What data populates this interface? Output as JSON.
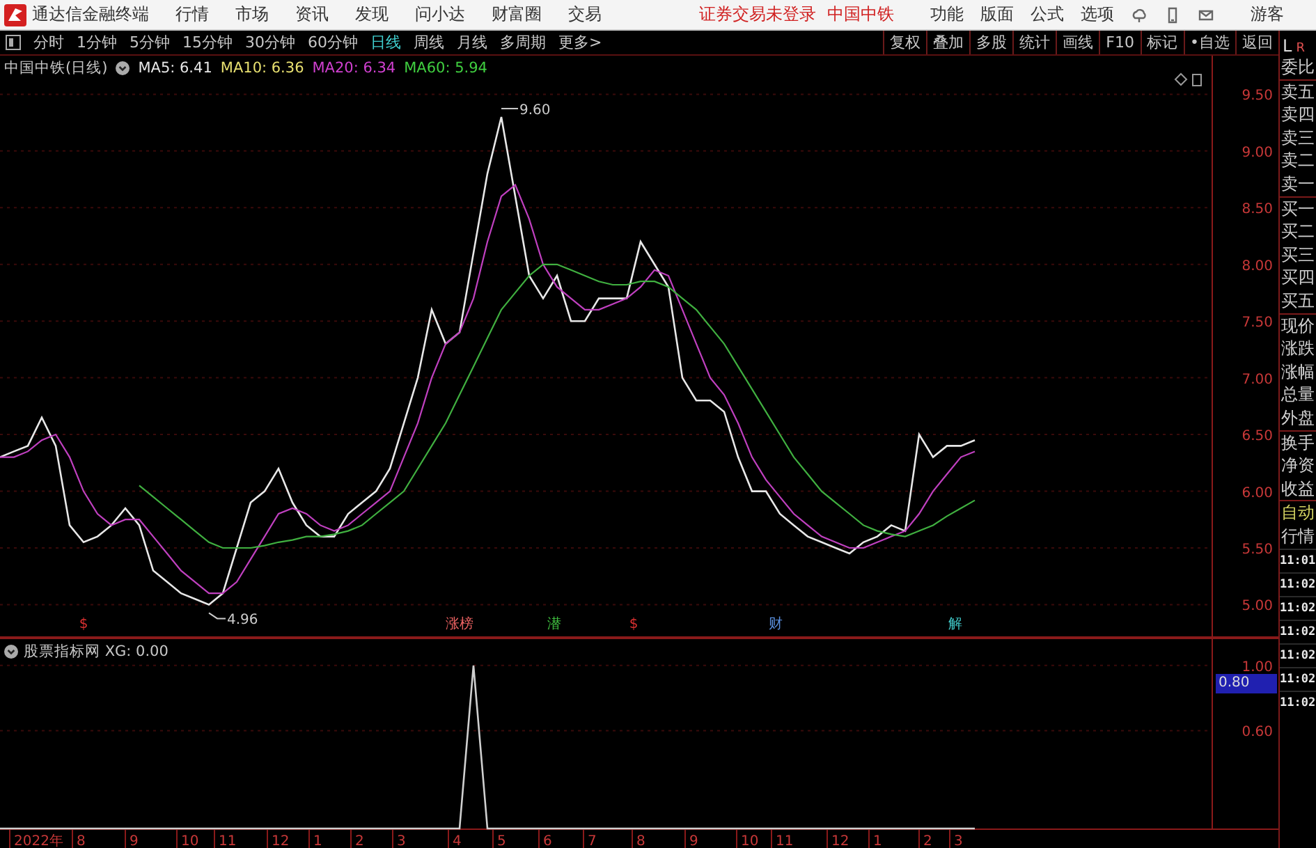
{
  "title_bar": {
    "app_title": "通达信金融终端",
    "menus": [
      "行情",
      "市场",
      "资讯",
      "发现",
      "问小达",
      "财富圈",
      "交易"
    ],
    "login_status": "证券交易未登录",
    "stock_name": "中国中铁",
    "tools": [
      "功能",
      "版面",
      "公式",
      "选项"
    ],
    "user": "游客"
  },
  "period_bar": {
    "periods": [
      {
        "label": "分时",
        "selected": false
      },
      {
        "label": "1分钟",
        "selected": false
      },
      {
        "label": "5分钟",
        "selected": false
      },
      {
        "label": "15分钟",
        "selected": false
      },
      {
        "label": "30分钟",
        "selected": false
      },
      {
        "label": "60分钟",
        "selected": false
      },
      {
        "label": "日线",
        "selected": true
      },
      {
        "label": "周线",
        "selected": false
      },
      {
        "label": "月线",
        "selected": false
      },
      {
        "label": "多周期",
        "selected": false
      },
      {
        "label": "更多>",
        "selected": false
      }
    ],
    "buttons": [
      "复权",
      "叠加",
      "多股",
      "统计",
      "画线",
      "F10",
      "标记",
      "•自选",
      "返回"
    ]
  },
  "main_chart": {
    "legend": {
      "title": "中国中铁(日线)",
      "ma": [
        {
          "label": "MA5: 6.41",
          "color": "#e8e8e8"
        },
        {
          "label": "MA10: 6.36",
          "color": "#e8e070"
        },
        {
          "label": "MA20: 6.34",
          "color": "#d040d0"
        },
        {
          "label": "MA60: 5.94",
          "color": "#40d040"
        }
      ]
    },
    "event_markers": [
      {
        "label": "$",
        "color": "#d83030"
      },
      {
        "label": "涨榜",
        "color": "#e86060"
      },
      {
        "label": "潜",
        "color": "#40c040"
      },
      {
        "label": "$",
        "color": "#d83030"
      },
      {
        "label": "财",
        "color": "#5a90e0"
      },
      {
        "label": "解",
        "color": "#40c8c8"
      }
    ],
    "chart_data": {
      "type": "line",
      "grid": true,
      "ylim": [
        4.72,
        9.84
      ],
      "yticks": [
        {
          "value": 5,
          "label": "5.00"
        },
        {
          "value": 5.5,
          "label": "5.50"
        },
        {
          "value": 6,
          "label": "6.00"
        },
        {
          "value": 6.5,
          "label": "6.50"
        },
        {
          "value": 7,
          "label": "7.00"
        },
        {
          "value": 7.5,
          "label": "7.50"
        },
        {
          "value": 8,
          "label": "8.00"
        },
        {
          "value": 8.5,
          "label": "8.50"
        },
        {
          "value": 9,
          "label": "9.00"
        },
        {
          "value": 9.5,
          "label": "9.50"
        }
      ],
      "categories": [
        null,
        null,
        null,
        null,
        null,
        null,
        null,
        null,
        null,
        null,
        null,
        null,
        null,
        null,
        null,
        null,
        null,
        null,
        null,
        null,
        null,
        null,
        null,
        null,
        null,
        null,
        null,
        null,
        null,
        null,
        null,
        null,
        null,
        null,
        null,
        null,
        null,
        null,
        null,
        null,
        null,
        null,
        null,
        null,
        null,
        null,
        null,
        null,
        null,
        null,
        null,
        null,
        null,
        null,
        null,
        null,
        null,
        null,
        null,
        null,
        null,
        null,
        null,
        null,
        null,
        null,
        null,
        null,
        null,
        null,
        null
      ],
      "series": [
        {
          "color": "#e8e8e8",
          "values": [
            6.3,
            6.35,
            6.4,
            6.65,
            6.4,
            5.7,
            5.55,
            5.6,
            5.7,
            5.85,
            5.7,
            5.3,
            5.2,
            5.1,
            5.05,
            5.0,
            5.1,
            5.5,
            5.9,
            6.0,
            6.2,
            5.9,
            5.7,
            5.6,
            5.6,
            5.8,
            5.9,
            6.0,
            6.2,
            6.6,
            7.0,
            7.6,
            7.3,
            7.4,
            8.1,
            8.8,
            9.3,
            8.6,
            7.9,
            7.7,
            7.9,
            7.5,
            7.5,
            7.7,
            7.7,
            7.7,
            8.2,
            8.0,
            7.8,
            7.0,
            6.8,
            6.8,
            6.7,
            6.3,
            6.0,
            6.0,
            5.8,
            5.7,
            5.6,
            5.55,
            5.5,
            5.45,
            5.55,
            5.6,
            5.7,
            5.65,
            6.5,
            6.3,
            6.4,
            6.4,
            6.45
          ]
        },
        {
          "color": "#c040c0",
          "values": [
            6.3,
            6.3,
            6.35,
            6.45,
            6.5,
            6.3,
            6.0,
            5.8,
            5.7,
            5.75,
            5.75,
            5.6,
            5.45,
            5.3,
            5.2,
            5.1,
            5.1,
            5.2,
            5.4,
            5.6,
            5.8,
            5.85,
            5.8,
            5.7,
            5.65,
            5.7,
            5.8,
            5.9,
            6.0,
            6.3,
            6.6,
            7.0,
            7.3,
            7.4,
            7.7,
            8.2,
            8.6,
            8.7,
            8.4,
            8.0,
            7.8,
            7.7,
            7.6,
            7.6,
            7.65,
            7.7,
            7.8,
            7.95,
            7.9,
            7.6,
            7.3,
            7.0,
            6.85,
            6.6,
            6.3,
            6.1,
            5.95,
            5.8,
            5.7,
            5.6,
            5.55,
            5.5,
            5.5,
            5.55,
            5.6,
            5.65,
            5.8,
            6.0,
            6.15,
            6.3,
            6.35
          ]
        },
        {
          "color": "#40b040",
          "values": [
            null,
            null,
            null,
            null,
            null,
            null,
            null,
            null,
            null,
            null,
            6.05,
            5.95,
            5.85,
            5.75,
            5.65,
            5.55,
            5.5,
            5.5,
            5.5,
            5.52,
            5.55,
            5.57,
            5.6,
            5.6,
            5.62,
            5.65,
            5.7,
            5.8,
            5.9,
            6.0,
            6.2,
            6.4,
            6.6,
            6.85,
            7.1,
            7.35,
            7.6,
            7.75,
            7.9,
            8.0,
            8.0,
            7.95,
            7.9,
            7.85,
            7.82,
            7.82,
            7.85,
            7.85,
            7.8,
            7.7,
            7.6,
            7.45,
            7.3,
            7.1,
            6.9,
            6.7,
            6.5,
            6.3,
            6.15,
            6.0,
            5.9,
            5.8,
            5.7,
            5.65,
            5.62,
            5.6,
            5.65,
            5.7,
            5.78,
            5.85,
            5.92
          ]
        }
      ],
      "annotations": [
        {
          "text": "9.60"
        },
        {
          "text": "4.96"
        }
      ]
    }
  },
  "indicator": {
    "legend": "股票指标网 XG: 0.00",
    "cursor_value": "0.80",
    "date_axis": [
      "2022年",
      "8",
      "9",
      "10",
      "11",
      "12",
      "1",
      "2",
      "3",
      "4",
      "5",
      "6",
      "7",
      "8",
      "9",
      "10",
      "11",
      "12",
      "1",
      "2",
      "3"
    ],
    "chart_data": {
      "type": "line",
      "grid": true,
      "ylim": [
        0,
        1.17
      ],
      "yticks": [
        {
          "value": 1,
          "label": "1.00"
        },
        {
          "value": 0.6,
          "label": "0.60"
        }
      ],
      "categories": [
        null,
        null,
        null,
        null,
        null,
        null,
        null,
        null,
        null,
        null,
        null,
        null,
        null,
        null,
        null,
        null,
        null,
        null,
        null,
        null,
        null,
        null,
        null,
        null,
        null,
        null,
        null,
        null,
        null,
        null,
        null,
        null,
        null,
        null,
        null,
        null,
        null,
        null,
        null,
        null,
        null,
        null,
        null,
        null,
        null,
        null,
        null,
        null,
        null,
        null,
        null,
        null,
        null,
        null,
        null,
        null,
        null,
        null,
        null,
        null,
        null,
        null,
        null,
        null,
        null,
        null,
        null,
        null,
        null,
        null,
        null
      ],
      "series": [
        {
          "color": "#d0d0d0",
          "values": [
            0,
            0,
            0,
            0,
            0,
            0,
            0,
            0,
            0,
            0,
            0,
            0,
            0,
            0,
            0,
            0,
            0,
            0,
            0,
            0,
            0,
            0,
            0,
            0,
            0,
            0,
            0,
            0,
            0,
            0,
            0,
            0,
            0,
            0,
            1,
            0,
            0,
            0,
            0,
            0,
            0,
            0,
            0,
            0,
            0,
            0,
            0,
            0,
            0,
            0,
            0,
            0,
            0,
            0,
            0,
            0,
            0,
            0,
            0,
            0,
            0,
            0,
            0,
            0,
            0,
            0,
            0,
            0,
            0,
            0,
            0
          ]
        }
      ]
    }
  },
  "quote_panel": {
    "corner": [
      "L",
      "R"
    ],
    "labels": [
      "委比",
      "卖五",
      "卖四",
      "卖三",
      "卖二",
      "卖一",
      "买一",
      "买二",
      "买三",
      "买四",
      "买五",
      "现价",
      "涨跌",
      "涨幅",
      "总量",
      "外盘",
      "换手",
      "净资",
      "收益"
    ],
    "mode_labels": [
      "自动",
      "行情"
    ],
    "times": [
      "11:01",
      "11:02",
      "11:02",
      "11:02",
      "11:02",
      "11:02",
      "11:02"
    ]
  }
}
